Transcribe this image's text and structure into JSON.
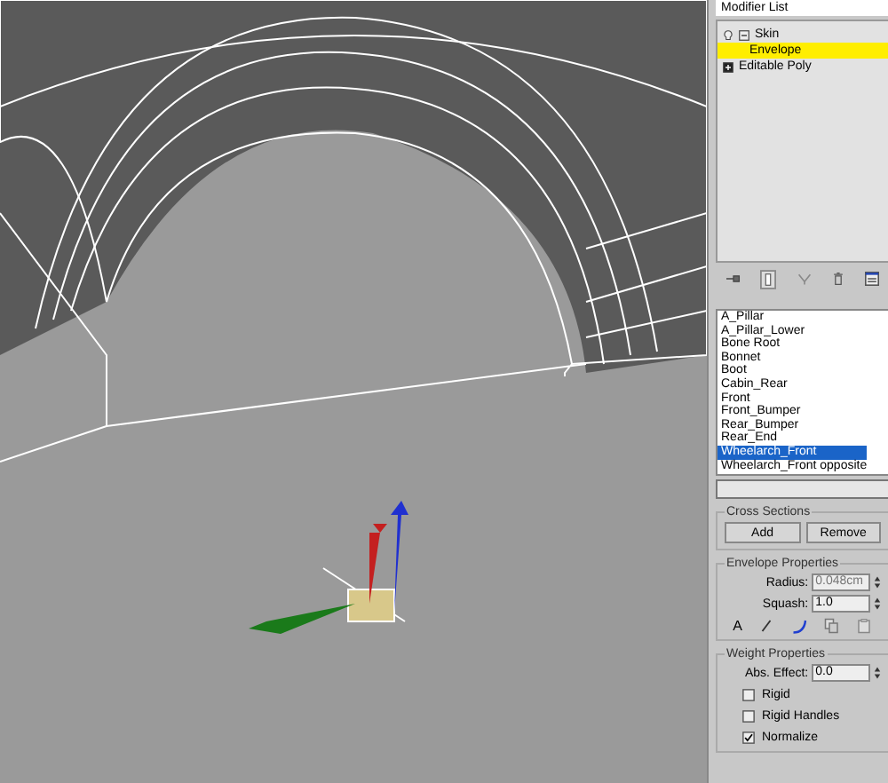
{
  "modifier_list": {
    "label": "Modifier List"
  },
  "modifier_stack": [
    {
      "label": "Skin",
      "expanded": true,
      "selected": false,
      "children": [
        {
          "label": "Envelope",
          "selected": true
        }
      ]
    },
    {
      "label": "Editable Poly",
      "expanded": false,
      "selected": false
    }
  ],
  "bones": [
    {
      "label": "A_Pillar",
      "selected": false
    },
    {
      "label": "A_Pillar_Lower",
      "selected": false
    },
    {
      "label": "Bone Root",
      "selected": false
    },
    {
      "label": "Bonnet",
      "selected": false
    },
    {
      "label": "Boot",
      "selected": false
    },
    {
      "label": "Cabin_Rear",
      "selected": false
    },
    {
      "label": "Front",
      "selected": false
    },
    {
      "label": "Front_Bumper",
      "selected": false
    },
    {
      "label": "Rear_Bumper",
      "selected": false
    },
    {
      "label": "Rear_End",
      "selected": false
    },
    {
      "label": "Wheelarch_Front",
      "selected": true
    },
    {
      "label": "Wheelarch_Front opposite",
      "selected": false
    }
  ],
  "cross_sections": {
    "title": "Cross Sections",
    "buttons": [
      "Add",
      "Remove"
    ]
  },
  "envelope_properties": {
    "title": "Envelope Properties",
    "fields": [
      {
        "label": "Radius:",
        "value": "0.048cm",
        "disabled": true
      },
      {
        "label": "Squash:",
        "value": "1.0",
        "disabled": false
      }
    ],
    "letter": "A"
  },
  "weight_properties": {
    "title": "Weight Properties",
    "abs_effect": {
      "label": "Abs. Effect:",
      "value": "0.0"
    },
    "options": [
      {
        "label": "Rigid",
        "checked": false
      },
      {
        "label": "Rigid Handles",
        "checked": false
      },
      {
        "label": "Normalize",
        "checked": true
      }
    ]
  }
}
